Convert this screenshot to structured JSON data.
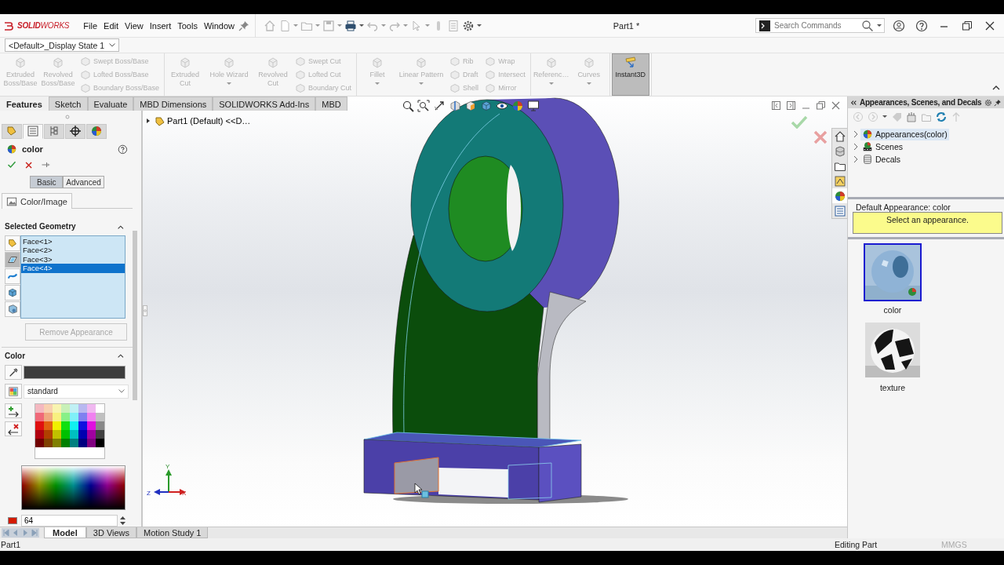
{
  "window": {
    "logo": "**SOLID**WORKS",
    "title": "Part1 *"
  },
  "menus": [
    {
      "label": "File"
    },
    {
      "label": "Edit"
    },
    {
      "label": "View"
    },
    {
      "label": "Insert"
    },
    {
      "label": "Tools"
    },
    {
      "label": "Window"
    }
  ],
  "search": {
    "placeholder": "Search Commands"
  },
  "display_state": {
    "value": "<Default>_Display State 1"
  },
  "command_groups": [
    {
      "items": [
        {
          "kind": "large",
          "label": "Extruded Boss/Base",
          "disabled": true,
          "active": false,
          "dropdown": false
        },
        {
          "kind": "large",
          "label": "Revolved Boss/Base",
          "disabled": true,
          "active": false,
          "dropdown": false
        },
        {
          "kind": "stack",
          "items": [
            {
              "label": "Swept Boss/Base",
              "disabled": true
            },
            {
              "label": "Lofted Boss/Base",
              "disabled": true
            },
            {
              "label": "Boundary Boss/Base",
              "disabled": true
            }
          ]
        }
      ]
    },
    {
      "items": [
        {
          "kind": "large",
          "label": "Extruded Cut",
          "disabled": true,
          "active": false,
          "dropdown": false
        },
        {
          "kind": "large",
          "label": "Hole Wizard",
          "disabled": true,
          "active": false,
          "dropdown": true
        },
        {
          "kind": "large",
          "label": "Revolved Cut",
          "disabled": true,
          "active": false,
          "dropdown": false
        },
        {
          "kind": "stack",
          "items": [
            {
              "label": "Swept Cut",
              "disabled": true
            },
            {
              "label": "Lofted Cut",
              "disabled": true
            },
            {
              "label": "Boundary Cut",
              "disabled": true
            }
          ]
        }
      ]
    },
    {
      "items": [
        {
          "kind": "large",
          "label": "Fillet",
          "disabled": true,
          "active": false,
          "dropdown": true
        },
        {
          "kind": "large",
          "label": "Linear Pattern",
          "disabled": true,
          "active": false,
          "dropdown": true
        },
        {
          "kind": "stack",
          "items": [
            {
              "label": "Rib",
              "disabled": true
            },
            {
              "label": "Draft",
              "disabled": true
            },
            {
              "label": "Shell",
              "disabled": true
            }
          ]
        },
        {
          "kind": "stack",
          "items": [
            {
              "label": "Wrap",
              "disabled": true
            },
            {
              "label": "Intersect",
              "disabled": true
            },
            {
              "label": "Mirror",
              "disabled": true
            }
          ]
        }
      ]
    },
    {
      "items": [
        {
          "kind": "large",
          "label": "Referenc…",
          "disabled": true,
          "active": false,
          "dropdown": true
        },
        {
          "kind": "large",
          "label": "Curves",
          "disabled": true,
          "active": false,
          "dropdown": true
        }
      ]
    },
    {
      "items": [
        {
          "kind": "large",
          "label": "Instant3D",
          "disabled": false,
          "active": true,
          "dropdown": false
        }
      ]
    }
  ],
  "tabs": [
    {
      "label": "Features",
      "selected": true
    },
    {
      "label": "Sketch",
      "selected": false
    },
    {
      "label": "Evaluate",
      "selected": false
    },
    {
      "label": "MBD Dimensions",
      "selected": false
    },
    {
      "label": "SOLIDWORKS Add-Ins",
      "selected": false
    },
    {
      "label": "MBD",
      "selected": false
    }
  ],
  "property_manager": {
    "panel_tabs": [
      {
        "selected": false
      },
      {
        "selected": true
      },
      {
        "selected": false
      },
      {
        "selected": false
      },
      {
        "selected": false
      }
    ],
    "title": "color",
    "modes": [
      {
        "label": "Basic",
        "selected": true
      },
      {
        "label": "Advanced",
        "selected": false
      }
    ],
    "section_tab": "Color/Image",
    "geometry": {
      "heading": "Selected Geometry",
      "filters": [
        {
          "selected": false
        },
        {
          "selected": true
        },
        {
          "selected": false
        },
        {
          "selected": false
        },
        {
          "selected": false
        }
      ],
      "faces": [
        {
          "label": "Face<1>",
          "selected": false
        },
        {
          "label": "Face<2>",
          "selected": false
        },
        {
          "label": "Face<3>",
          "selected": false
        },
        {
          "label": "Face<4>",
          "selected": true
        }
      ],
      "remove_button": {
        "label": "Remove Appearance",
        "disabled": true
      }
    },
    "color": {
      "heading": "Color",
      "color": "#3d3d3d",
      "palette": "standard",
      "value": {
        "text": "64",
        "color": "#d41a00"
      }
    }
  },
  "tree": {
    "label": "Part1 (Default) <<D…"
  },
  "task_pane_tabs": [
    {
      "selected": false
    },
    {
      "selected": false
    },
    {
      "selected": false
    },
    {
      "selected": false
    },
    {
      "selected": true
    },
    {
      "selected": false
    }
  ],
  "triad": {
    "x": "X",
    "y": "Y",
    "z": "Z"
  },
  "appearances_panel": {
    "title": "Appearances, Scenes, and Decals",
    "tree": [
      {
        "label": "Appearances(color)",
        "kind": "appearances",
        "selected": true
      },
      {
        "label": "Scenes",
        "kind": "scenes",
        "selected": false
      },
      {
        "label": "Decals",
        "kind": "decals",
        "selected": false
      }
    ],
    "default_label": "Default Appearance: color",
    "message": "Select an appearance.",
    "thumbnails": [
      {
        "label": "color",
        "kind": "solid",
        "selected": true
      },
      {
        "label": "texture",
        "kind": "checker",
        "selected": false
      }
    ]
  },
  "bottom_tabs": [
    {
      "label": "Model",
      "selected": true
    },
    {
      "label": "3D Views",
      "selected": false
    },
    {
      "label": "Motion Study 1",
      "selected": false
    }
  ],
  "status_bar": {
    "document": "Part1",
    "mode": "Editing Part",
    "units": "MMGS"
  }
}
